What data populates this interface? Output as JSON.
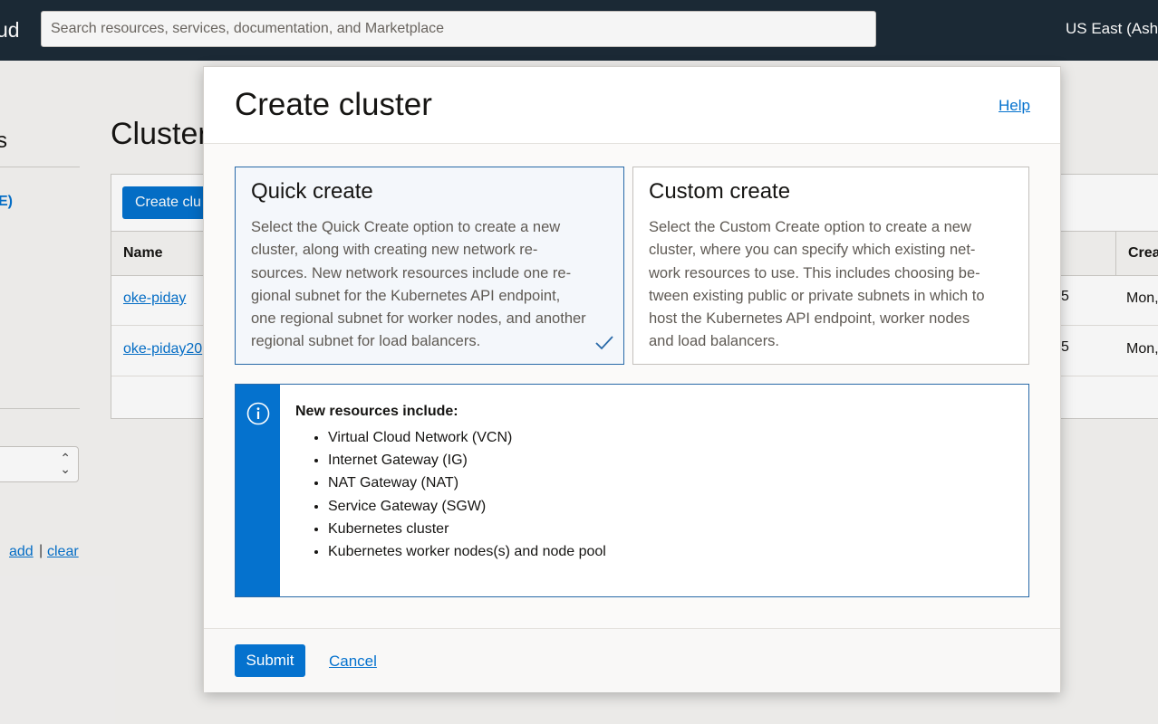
{
  "topbar": {
    "brand_fragment": "ud",
    "search_placeholder": "Search resources, services, documentation, and Marketplace",
    "region": "US East (Ash"
  },
  "background": {
    "side_title_fragment": "s",
    "side_link_fragment": "E)",
    "tags": {
      "add": "add",
      "separator": "|",
      "clear": "clear"
    },
    "page_title": "Cluster",
    "create_button": "Create clu",
    "columns": {
      "name": "Name",
      "created": "Crea"
    },
    "rows": [
      {
        "name": "oke-piday",
        "num": "5",
        "date": "Mon,"
      },
      {
        "name": "oke-piday20",
        "num": "5",
        "date": "Mon,"
      }
    ]
  },
  "dialog": {
    "title": "Create cluster",
    "help": "Help",
    "options": [
      {
        "title": "Quick create",
        "description": "Select the Quick Create option to create a new\ncluster, along with creating new network re-\nsources. New network resources include one re-\ngional subnet for the Kubernetes API endpoint,\none regional subnet for worker nodes, and another\nregional subnet for load balancers.",
        "selected": true
      },
      {
        "title": "Custom create",
        "description": "Select the Custom Create option to create a new\ncluster, where you can specify which existing net-\nwork resources to use. This includes choosing be-\ntween existing public or private subnets in which to\nhost the Kubernetes API endpoint, worker nodes\nand load balancers.",
        "selected": false
      }
    ],
    "info": {
      "heading": "New resources include:",
      "items": [
        "Virtual Cloud Network (VCN)",
        "Internet Gateway (IG)",
        "NAT Gateway (NAT)",
        "Service Gateway (SGW)",
        "Kubernetes cluster",
        "Kubernetes worker nodes(s) and node pool"
      ]
    },
    "submit": "Submit",
    "cancel": "Cancel"
  },
  "colors": {
    "topbar": "#1d2b38",
    "accent": "#0572ce",
    "selected_border": "#2869a8"
  }
}
